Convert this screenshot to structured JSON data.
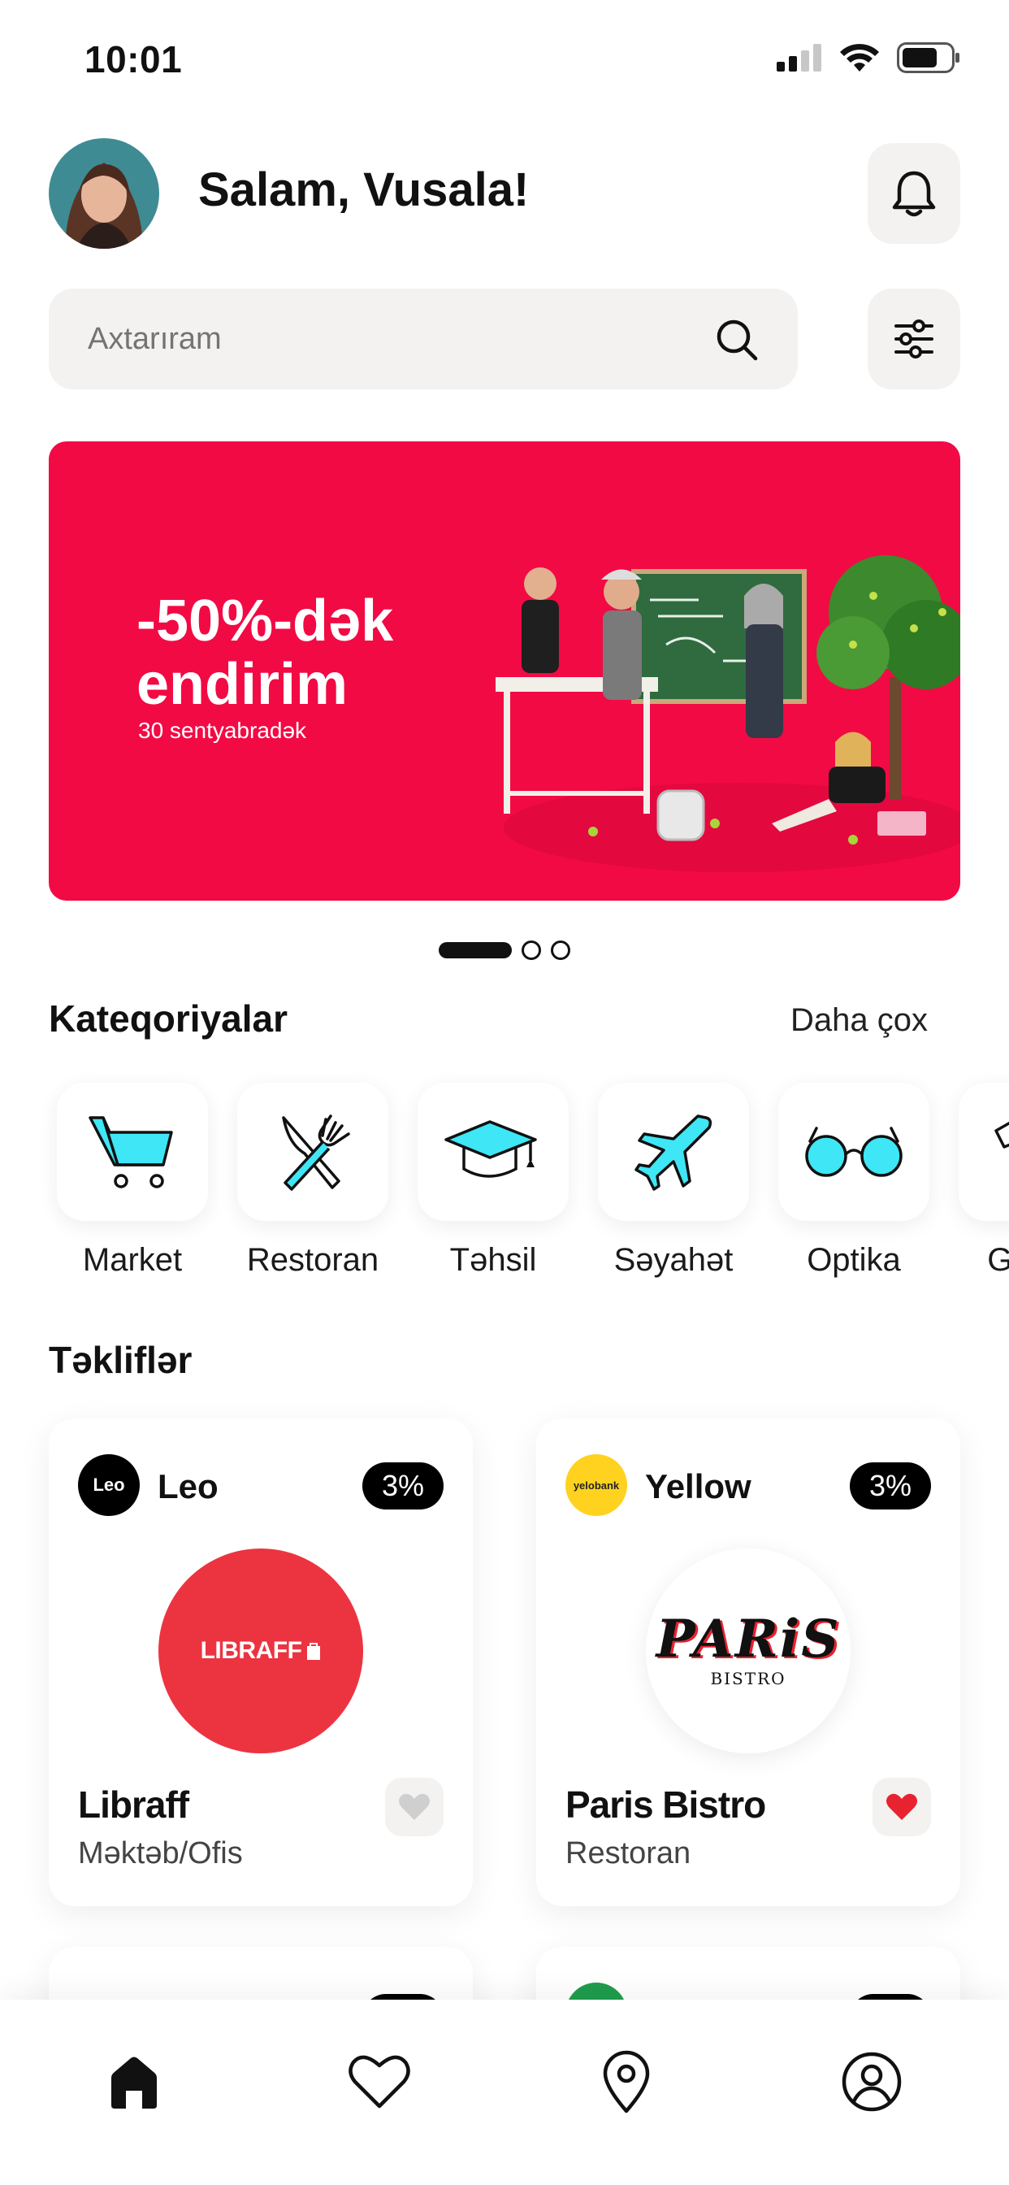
{
  "status_bar": {
    "time": "10:01"
  },
  "header": {
    "greeting": "Salam, Vusala!"
  },
  "search": {
    "placeholder": "Axtarıram"
  },
  "banner": {
    "title": "-50%-dək\nendirim",
    "subtitle": "30 sentyabradək",
    "accent_color": "#f20a44",
    "slide_count": 3,
    "active_slide": 1
  },
  "categories": {
    "title": "Kateqoriyalar",
    "see_more": "Daha çox",
    "items": [
      {
        "label": "Market",
        "icon": "shopping-cart-icon"
      },
      {
        "label": "Restoran",
        "icon": "fork-knife-icon"
      },
      {
        "label": "Təhsil",
        "icon": "graduation-cap-icon"
      },
      {
        "label": "Səyahət",
        "icon": "airplane-icon"
      },
      {
        "label": "Optika",
        "icon": "glasses-icon"
      },
      {
        "label": "Geyim",
        "icon": "tshirt-icon"
      }
    ]
  },
  "offers": {
    "title": "Təkliflər",
    "items": [
      {
        "bank_logo": "Leo",
        "bank": "Leo",
        "discount": "3%",
        "merchant_logo": "LIBRAFF",
        "name": "Libraff",
        "category": "Məktəb/Ofis",
        "favorited": false
      },
      {
        "bank_logo": "yelobank",
        "bank": "Yellow",
        "discount": "3%",
        "merchant_logo": "PARiS",
        "merchant_logo_sub": "BISTRO",
        "name": "Paris Bistro",
        "category": "Restoran",
        "favorited": true
      }
    ]
  },
  "colors": {
    "accent_cyan": "#3fe6f5",
    "heart_red": "#e8232f",
    "libraff_red": "#ec3441",
    "yellow_bank": "#ffd21f"
  },
  "bottom_nav": {
    "items": [
      "home-icon",
      "heart-icon",
      "location-pin-icon",
      "profile-icon"
    ],
    "active": "home-icon"
  }
}
